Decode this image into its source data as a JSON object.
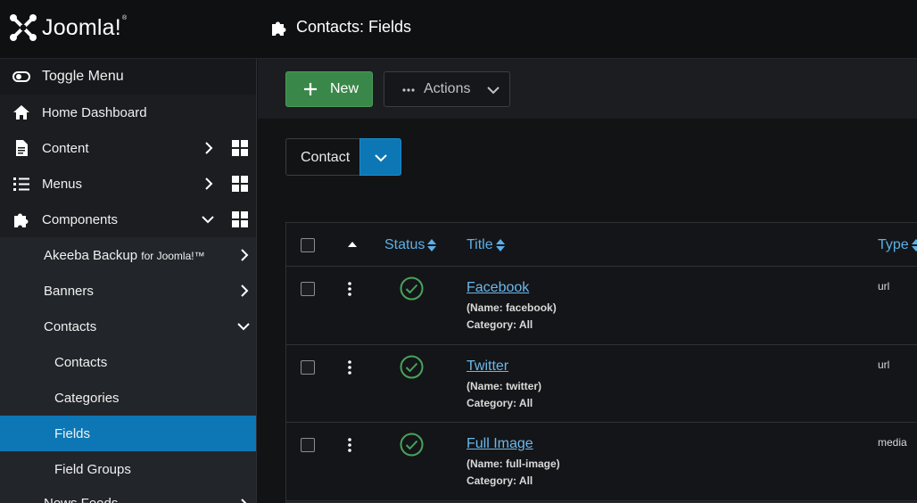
{
  "brand": {
    "name": "Joomla!",
    "registered": "®"
  },
  "header": {
    "title": "Contacts: Fields",
    "icon": "puzzle-icon"
  },
  "sidebar": {
    "toggle_label": "Toggle Menu",
    "items": [
      {
        "label": "Home Dashboard",
        "icon": "home-icon"
      },
      {
        "label": "Content",
        "icon": "file-icon"
      },
      {
        "label": "Menus",
        "icon": "list-icon"
      },
      {
        "label": "Components",
        "icon": "puzzle-icon"
      }
    ],
    "components": [
      {
        "label": "Akeeba Backup",
        "suffix": "for Joomla!™"
      },
      {
        "label": "Banners"
      },
      {
        "label": "Contacts"
      }
    ],
    "contacts_sub": [
      {
        "label": "Contacts"
      },
      {
        "label": "Categories"
      },
      {
        "label": "Fields",
        "active": true
      },
      {
        "label": "Field Groups"
      }
    ],
    "next_partial": "News Feeds"
  },
  "toolbar": {
    "new_label": "New",
    "actions_label": "Actions"
  },
  "context_select": {
    "value": "Contact"
  },
  "table": {
    "headers": {
      "status": "Status",
      "title": "Title",
      "type": "Type"
    },
    "rows": [
      {
        "title": "Facebook",
        "name": "(Name: facebook)",
        "category": "Category: All",
        "type": "url"
      },
      {
        "title": "Twitter",
        "name": "(Name: twitter)",
        "category": "Category: All",
        "type": "url"
      },
      {
        "title": "Full Image",
        "name": "(Name: full-image)",
        "category": "Category: All",
        "type": "media"
      }
    ]
  },
  "colors": {
    "accent": "#0d77b5",
    "success": "#3a8849",
    "link": "#6cb8ea"
  }
}
